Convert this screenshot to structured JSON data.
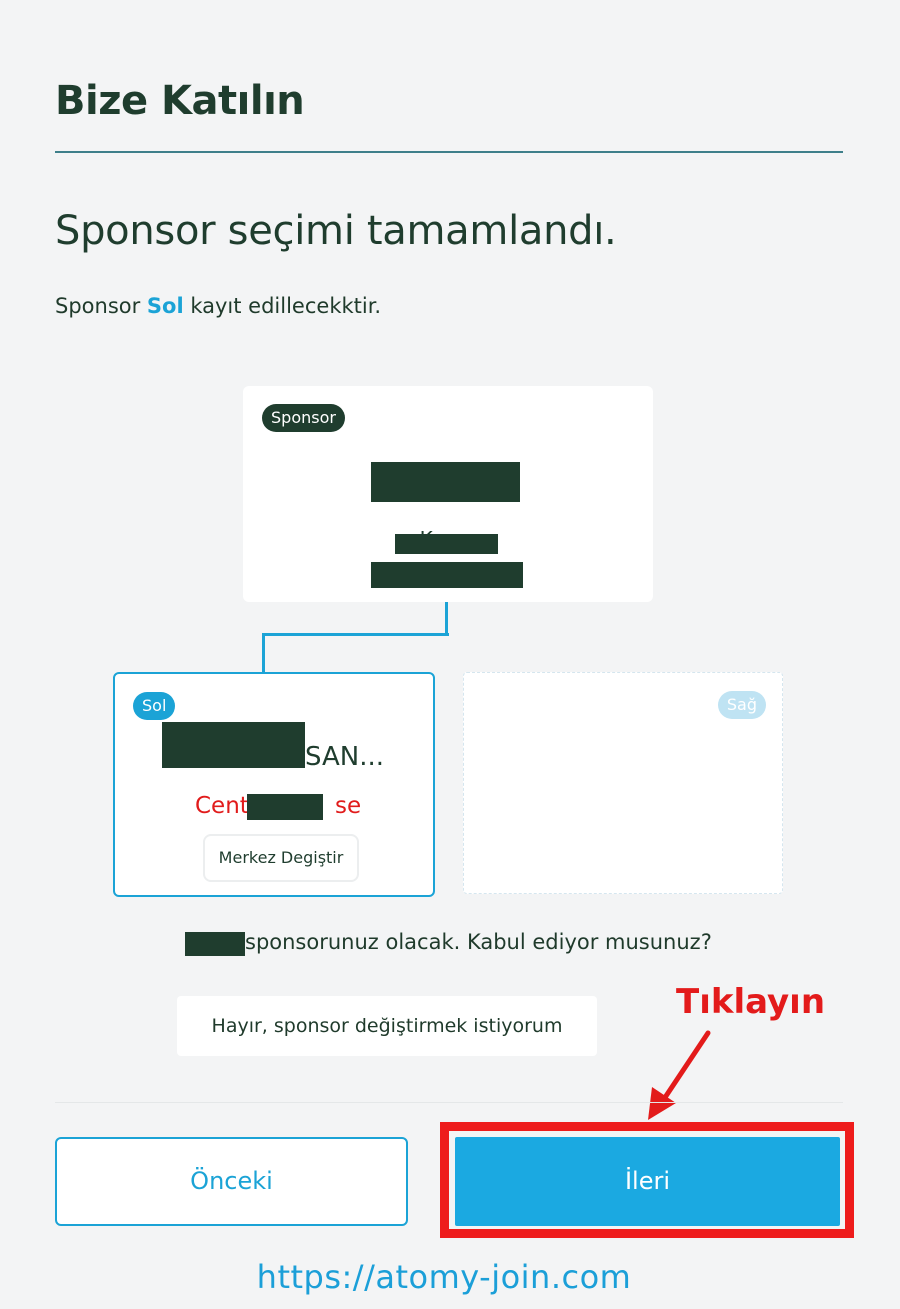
{
  "header": {
    "title": "Bize Katılın"
  },
  "main": {
    "headline": "Sponsor seçimi tamamlandı.",
    "subline_before": "Sponsor ",
    "subline_highlight": "Sol",
    "subline_after": " kayıt edillecekktir."
  },
  "sponsor_card": {
    "badge": "Sponsor",
    "faint_text": "Korea"
  },
  "left_card": {
    "badge": "Sol",
    "name_suffix": "SAN...",
    "center_left": "Cent",
    "center_right": "se",
    "change_center_label": "Merkez Degiştir"
  },
  "right_card": {
    "badge": "Sağ"
  },
  "question": {
    "text": "sponsorunuz olacak. Kabul ediyor musunuz?"
  },
  "actions": {
    "change_sponsor_label": "Hayır, sponsor değiştirmek istiyorum",
    "prev_label": "Önceki",
    "next_label": "İleri"
  },
  "annotation": {
    "label": "Tıklayın",
    "color": "#e31b1b"
  },
  "watermark": {
    "url": "https://atomy-join.com"
  },
  "colors": {
    "accent": "#1ba3d6",
    "dark_green": "#1f3d2e",
    "alert_red": "#e11b1b"
  }
}
